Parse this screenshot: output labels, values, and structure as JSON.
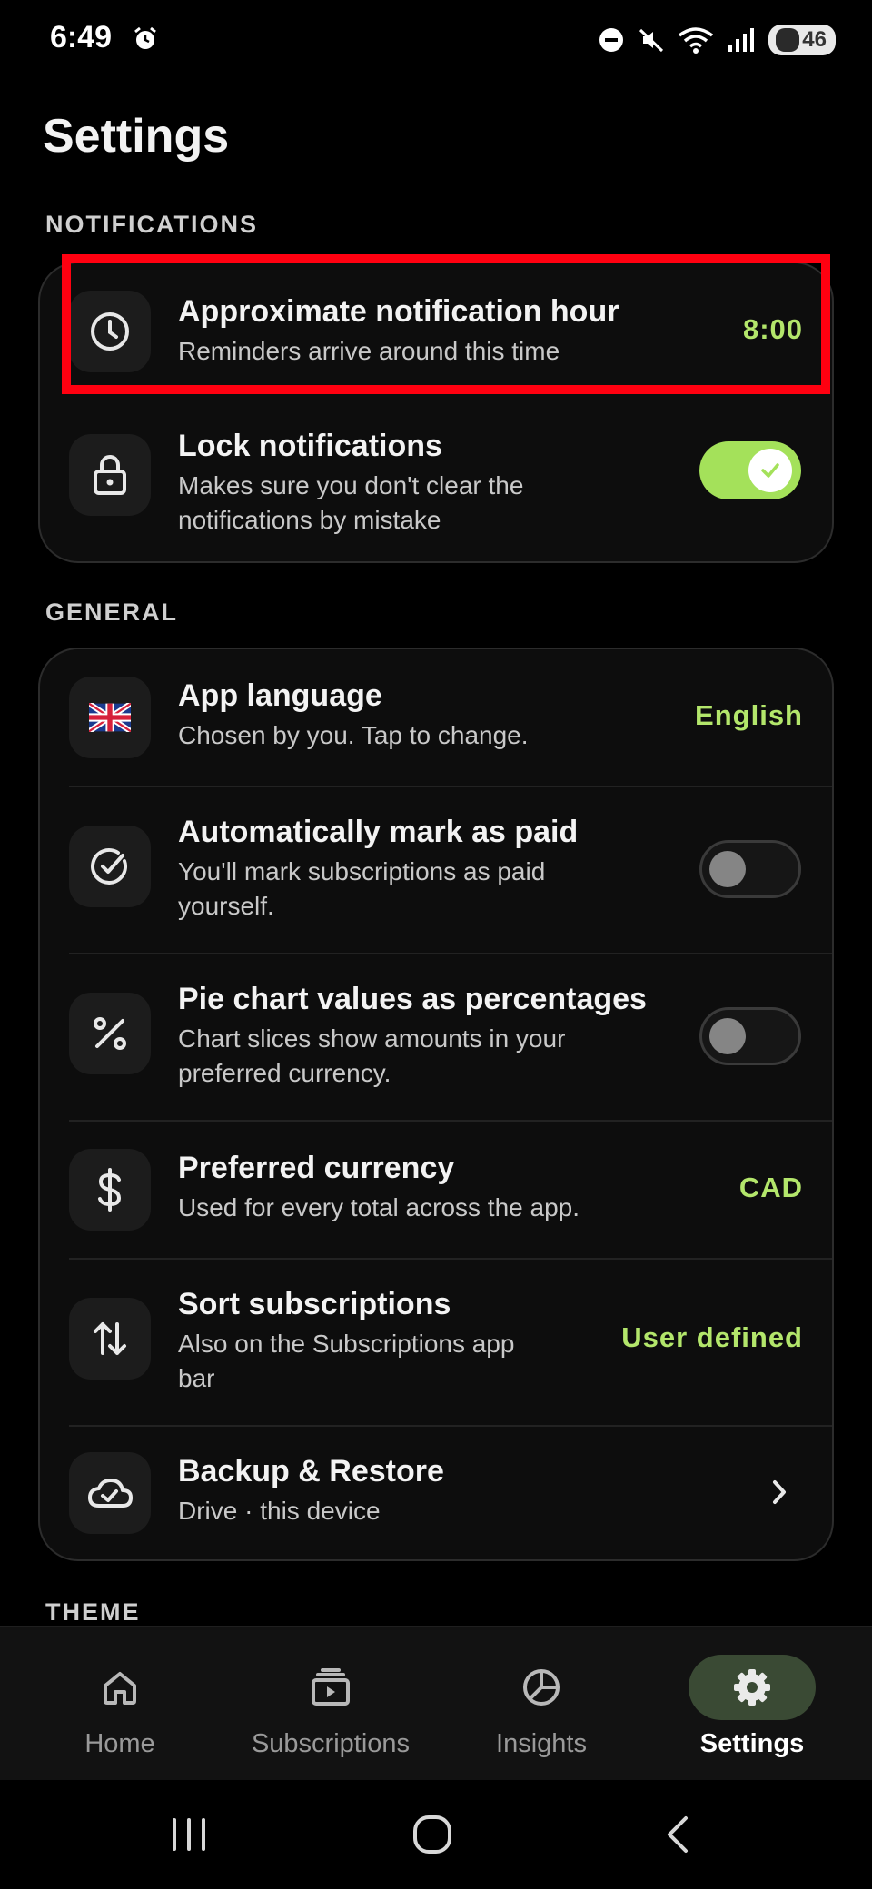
{
  "status_bar": {
    "time": "6:49",
    "battery": "46",
    "icons": [
      "alarm-icon",
      "do-not-disturb-icon",
      "mute-icon",
      "wifi-icon",
      "signal-icon",
      "battery-icon"
    ]
  },
  "page": {
    "title": "Settings"
  },
  "sections": {
    "notifications": {
      "label": "NOTIFICATIONS",
      "items": [
        {
          "icon": "clock-icon",
          "title": "Approximate notification hour",
          "subtitle": "Reminders arrive around this time",
          "value": "8:00"
        },
        {
          "icon": "lock-icon",
          "title": "Lock notifications",
          "subtitle_lines": [
            "Makes sure you don't clear the",
            "notifications by mistake"
          ],
          "toggle": true
        }
      ]
    },
    "general": {
      "label": "GENERAL",
      "items": [
        {
          "icon": "uk-flag-icon",
          "title": "App language",
          "subtitle": "Chosen by you. Tap to change.",
          "value": "English"
        },
        {
          "icon": "check-circle-icon",
          "title": "Automatically mark as paid",
          "subtitle_lines": [
            "You'll mark subscriptions as paid",
            "yourself."
          ],
          "toggle": false
        },
        {
          "icon": "percent-icon",
          "title": "Pie chart values as percentages",
          "subtitle_lines": [
            "Chart slices show amounts in your",
            "preferred currency."
          ],
          "toggle": false
        },
        {
          "icon": "dollar-icon",
          "title": "Preferred currency",
          "subtitle": "Used for every total across the app.",
          "value": "CAD"
        },
        {
          "icon": "sort-arrows-icon",
          "title": "Sort subscriptions",
          "subtitle_lines": [
            "Also on the Subscriptions app",
            "bar"
          ],
          "value": "User defined"
        },
        {
          "icon": "cloud-check-icon",
          "title": "Backup & Restore",
          "subtitle": "Drive · this device",
          "chevron": "chevron-right-icon"
        }
      ]
    },
    "theme": {
      "label": "THEME"
    }
  },
  "bottom_nav": {
    "items": [
      {
        "icon": "home-icon",
        "label": "Home",
        "active": false
      },
      {
        "icon": "subscriptions-icon",
        "label": "Subscriptions",
        "active": false
      },
      {
        "icon": "insights-icon",
        "label": "Insights",
        "active": false
      },
      {
        "icon": "gear-icon",
        "label": "Settings",
        "active": true
      }
    ]
  },
  "system_nav": [
    "recents-icon",
    "home-circle-icon",
    "back-icon"
  ],
  "colors": {
    "accent": "#b3e66b",
    "toggle_on": "#a4e15a",
    "highlight": "#ff0010",
    "background": "#000000",
    "card": "#0d0d0d"
  }
}
